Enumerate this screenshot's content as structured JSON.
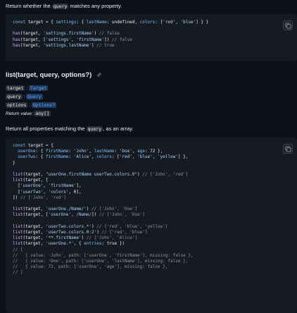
{
  "intro": {
    "prefix": "Return whether the",
    "chip": "query",
    "suffix": "matches any property."
  },
  "code1": [
    [
      [
        "kw",
        "const "
      ],
      [
        "id",
        "target = { "
      ],
      [
        "key",
        "settings"
      ],
      [
        "id",
        ": { "
      ],
      [
        "key",
        "lastName"
      ],
      [
        "id",
        ": undefined, "
      ],
      [
        "key",
        "colors"
      ],
      [
        "id",
        ": ["
      ],
      [
        "str",
        "'red'"
      ],
      [
        "id",
        ", "
      ],
      [
        "str",
        "'blue'"
      ],
      [
        "id",
        "] } }"
      ]
    ],
    [],
    [
      [
        "fn",
        "has"
      ],
      [
        "id",
        "(target, "
      ],
      [
        "str",
        "'settings.firstName'"
      ],
      [
        "id",
        ") "
      ],
      [
        "cm",
        "// false"
      ]
    ],
    [
      [
        "fn",
        "has"
      ],
      [
        "id",
        "(target, ["
      ],
      [
        "str",
        "'settings'"
      ],
      [
        "id",
        ", "
      ],
      [
        "str",
        "'firstName'"
      ],
      [
        "id",
        "]) "
      ],
      [
        "cm",
        "// false"
      ]
    ],
    [
      [
        "fn",
        "has"
      ],
      [
        "id",
        "(target, "
      ],
      [
        "str",
        "'settings.lastName'"
      ],
      [
        "id",
        ") "
      ],
      [
        "cm",
        "// true"
      ]
    ]
  ],
  "heading": "list(target, query, options?)",
  "params": [
    {
      "name": "target",
      "type": "Target"
    },
    {
      "name": "query",
      "type": "Query"
    },
    {
      "name": "options",
      "type": "Options?"
    }
  ],
  "return_value": {
    "label": "Return value:",
    "type": "any[]"
  },
  "desc": {
    "prefix": "Return all properties matching the",
    "chip": "query",
    "suffix": ", as an array."
  },
  "code2": [
    [
      [
        "kw",
        "const "
      ],
      [
        "id",
        "target = {"
      ]
    ],
    [
      [
        "id",
        "  "
      ],
      [
        "key",
        "userOne"
      ],
      [
        "id",
        ": { "
      ],
      [
        "key",
        "firstName"
      ],
      [
        "id",
        ": "
      ],
      [
        "str",
        "'John'"
      ],
      [
        "id",
        ", "
      ],
      [
        "key",
        "lastName"
      ],
      [
        "id",
        ": "
      ],
      [
        "str",
        "'Doe'"
      ],
      [
        "id",
        ", "
      ],
      [
        "key",
        "age"
      ],
      [
        "id",
        ": 72 },"
      ]
    ],
    [
      [
        "id",
        "  "
      ],
      [
        "key",
        "userTwo"
      ],
      [
        "id",
        ": { "
      ],
      [
        "key",
        "firstName"
      ],
      [
        "id",
        ": "
      ],
      [
        "str",
        "'Alice'"
      ],
      [
        "id",
        ", "
      ],
      [
        "key",
        "colors"
      ],
      [
        "id",
        ": ["
      ],
      [
        "str",
        "'red'"
      ],
      [
        "id",
        ", "
      ],
      [
        "str",
        "'blue'"
      ],
      [
        "id",
        ", "
      ],
      [
        "str",
        "'yellow'"
      ],
      [
        "id",
        "] },"
      ]
    ],
    [
      [
        "id",
        "}"
      ]
    ],
    [],
    [
      [
        "fn",
        "list"
      ],
      [
        "id",
        "(target, "
      ],
      [
        "str",
        "\"userOne.firstName userTwo.colors.0\""
      ],
      [
        "id",
        ") "
      ],
      [
        "cm",
        "// ['John', 'red']"
      ]
    ],
    [
      [
        "fn",
        "list"
      ],
      [
        "id",
        "(target, ["
      ]
    ],
    [
      [
        "id",
        "  ["
      ],
      [
        "str",
        "'userOne'"
      ],
      [
        "id",
        ", "
      ],
      [
        "str",
        "'firstName'"
      ],
      [
        "id",
        "],"
      ]
    ],
    [
      [
        "id",
        "  ["
      ],
      [
        "str",
        "'userTwo'"
      ],
      [
        "id",
        ", "
      ],
      [
        "str",
        "'colors'"
      ],
      [
        "id",
        ", 0],"
      ]
    ],
    [
      [
        "id",
        "]) "
      ],
      [
        "cm",
        "// ['John', 'red']"
      ]
    ],
    [],
    [
      [
        "fn",
        "list"
      ],
      [
        "id",
        "(target, "
      ],
      [
        "str",
        "'userOne./Name/'"
      ],
      [
        "id",
        ") "
      ],
      [
        "cm",
        "// ['John', 'Doe']"
      ]
    ],
    [
      [
        "fn",
        "list"
      ],
      [
        "id",
        "(target, ["
      ],
      [
        "str",
        "'userOne'"
      ],
      [
        "id",
        ", "
      ],
      [
        "str",
        "/Name/"
      ],
      [
        "id",
        "]) "
      ],
      [
        "cm",
        "// ['John', 'Doe']"
      ]
    ],
    [],
    [
      [
        "fn",
        "list"
      ],
      [
        "id",
        "(target, "
      ],
      [
        "str",
        "'userTwo.colors.*'"
      ],
      [
        "id",
        ") "
      ],
      [
        "cm",
        "// ['red', 'blue', 'yellow']"
      ]
    ],
    [
      [
        "fn",
        "list"
      ],
      [
        "id",
        "(target, "
      ],
      [
        "str",
        "'userTwo.colors.0:2'"
      ],
      [
        "id",
        ") "
      ],
      [
        "cm",
        "// ['red', 'blue']"
      ]
    ],
    [
      [
        "fn",
        "list"
      ],
      [
        "id",
        "(target, "
      ],
      [
        "str",
        "'**.firstName'"
      ],
      [
        "id",
        ") "
      ],
      [
        "cm",
        "// ['John', 'Alice']"
      ]
    ],
    [
      [
        "fn",
        "list"
      ],
      [
        "id",
        "(target, "
      ],
      [
        "str",
        "'userOne.*'"
      ],
      [
        "id",
        ", { "
      ],
      [
        "key",
        "entries"
      ],
      [
        "id",
        ": true })"
      ]
    ],
    [
      [
        "cm",
        "// ["
      ]
    ],
    [
      [
        "cm",
        "//   { value: 'John', path: ['userOne', 'firstName'], missing: false },"
      ]
    ],
    [
      [
        "cm",
        "//   { value: 'Doe', path: ['userOne', 'lastName'], missing: false },"
      ]
    ],
    [
      [
        "cm",
        "//   { value: 72, path: ['userOne', 'age'], missing: false },"
      ]
    ],
    [
      [
        "cm",
        "// ]"
      ]
    ]
  ],
  "icons": {
    "copy1": "copy-icon",
    "copy2": "copy-icon",
    "link": "link-icon"
  }
}
